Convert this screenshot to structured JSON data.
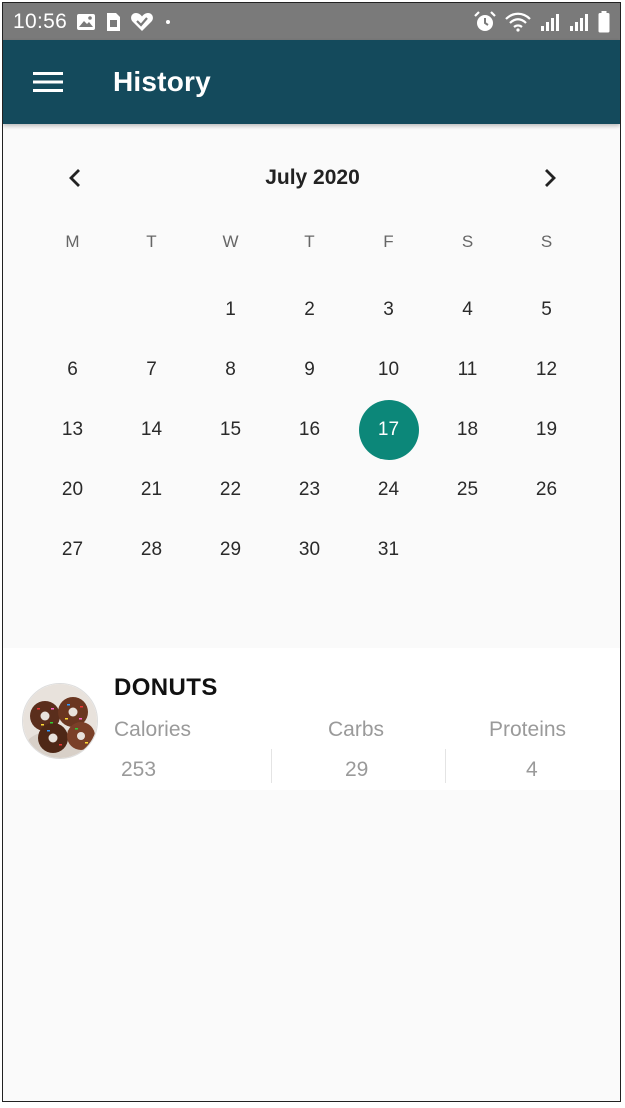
{
  "status_bar": {
    "time": "10:56",
    "left_icons": [
      "image-icon",
      "sim-card-icon",
      "heart-check-icon",
      "dot-icon"
    ],
    "right_icons": [
      "alarm-icon",
      "wifi-icon",
      "signal-1-icon",
      "signal-2-icon",
      "battery-icon"
    ]
  },
  "app_bar": {
    "title": "History",
    "background": "#144a5c"
  },
  "calendar": {
    "month_label": "July 2020",
    "weekdays": [
      "M",
      "T",
      "W",
      "T",
      "F",
      "S",
      "S"
    ],
    "leading_blanks": 2,
    "days": [
      "1",
      "2",
      "3",
      "4",
      "5",
      "6",
      "7",
      "8",
      "9",
      "10",
      "11",
      "12",
      "13",
      "14",
      "15",
      "16",
      "17",
      "18",
      "19",
      "20",
      "21",
      "22",
      "23",
      "24",
      "25",
      "26",
      "27",
      "28",
      "29",
      "30",
      "31"
    ],
    "selected_day": "17",
    "selected_color": "#0c8779"
  },
  "food_entry": {
    "name": "DONUTS",
    "stats": [
      {
        "label": "Calories",
        "value": "253"
      },
      {
        "label": "Carbs",
        "value": "29"
      },
      {
        "label": "Proteins",
        "value": "4"
      }
    ]
  }
}
